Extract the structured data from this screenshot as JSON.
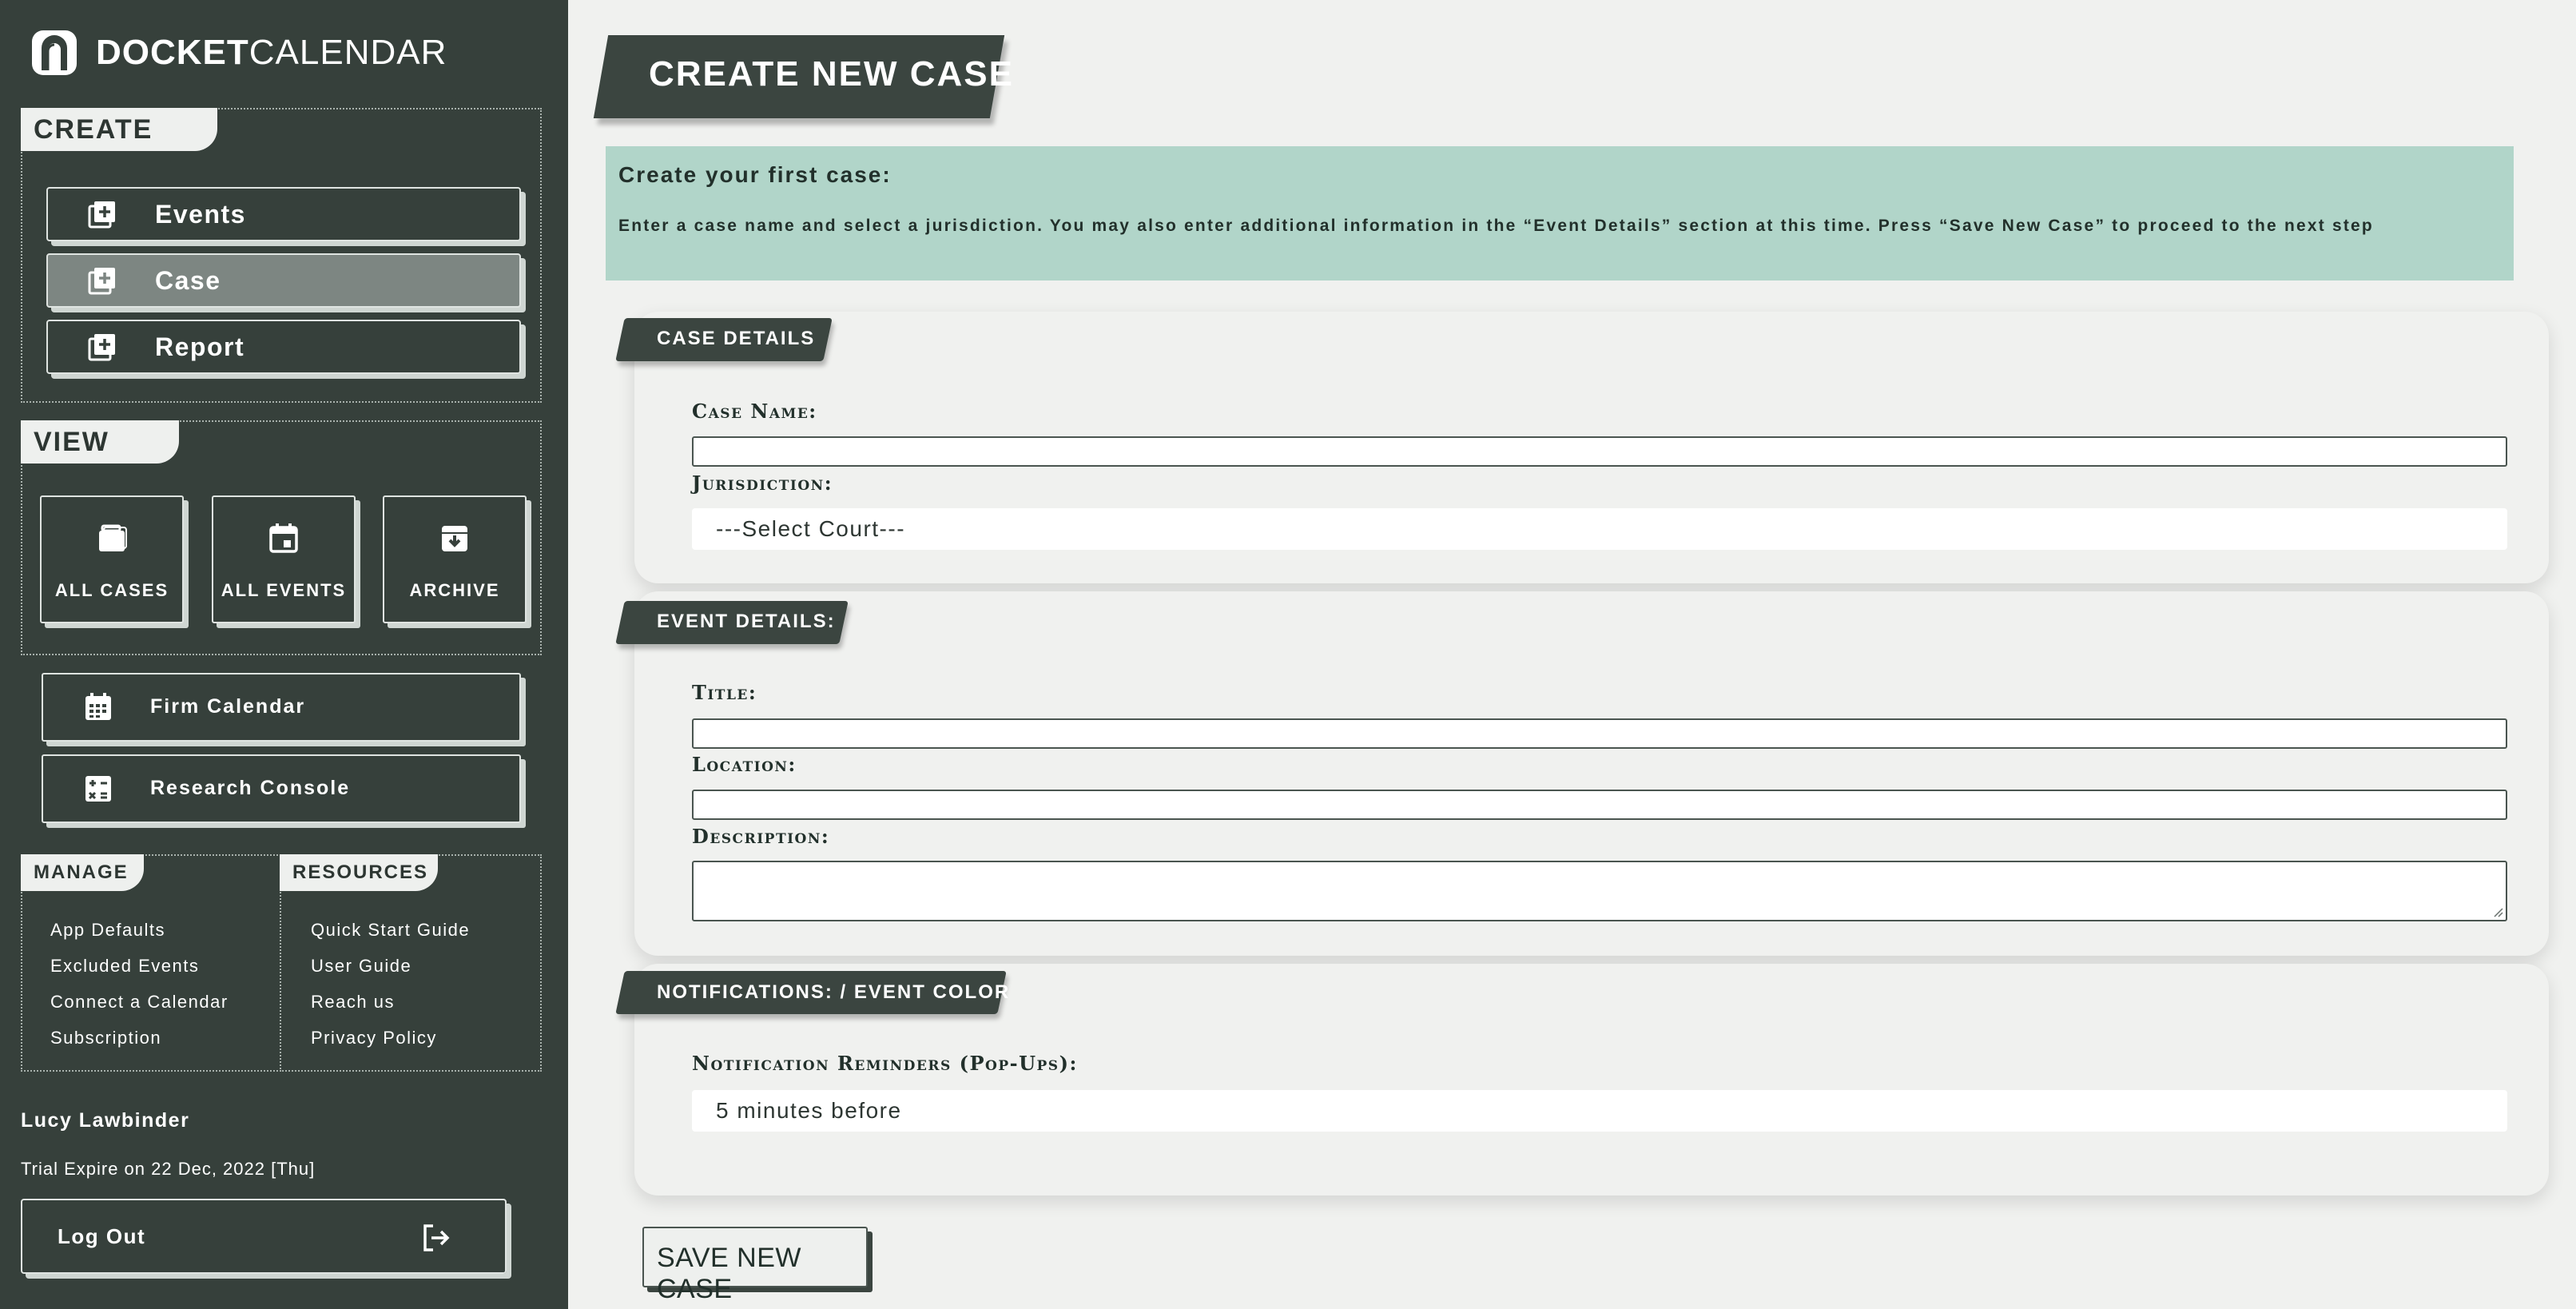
{
  "app": {
    "name_bold": "DOCKET",
    "name_light": "CALENDAR",
    "logo_icon": "arch-logo-icon"
  },
  "colors": {
    "sidebar_bg": "#36403b",
    "tab_dark": "#3b4540",
    "info_bg": "#b1d5c9",
    "page_bg": "#f0f1ef",
    "active_button": "#7d8682"
  },
  "sidebar": {
    "create": {
      "heading": "CREATE",
      "items": [
        {
          "label": "Events",
          "icon": "add-box-icon",
          "active": false
        },
        {
          "label": "Case",
          "icon": "add-box-icon",
          "active": true
        },
        {
          "label": "Report",
          "icon": "add-box-icon",
          "active": false
        }
      ]
    },
    "view": {
      "heading": "VIEW",
      "items": [
        {
          "label": "ALL CASES",
          "icon": "briefcase-icon"
        },
        {
          "label": "ALL EVENTS",
          "icon": "calendar-event-icon"
        },
        {
          "label": "ARCHIVE",
          "icon": "archive-icon"
        }
      ]
    },
    "buttons": [
      {
        "label": "Firm Calendar",
        "icon": "calendar-grid-icon"
      },
      {
        "label": "Research Console",
        "icon": "calculator-icon"
      }
    ],
    "manage": {
      "heading": "MANAGE",
      "items": [
        "App Defaults",
        "Excluded Events",
        "Connect a Calendar",
        "Subscription"
      ]
    },
    "resources": {
      "heading": "RESOURCES",
      "items": [
        "Quick Start Guide",
        "User Guide",
        "Reach us",
        "Privacy Policy"
      ]
    },
    "user": {
      "name": "Lucy Lawbinder",
      "trial": "Trial Expire on 22 Dec, 2022 [Thu]"
    },
    "logout": {
      "label": "Log Out",
      "icon": "logout-icon"
    }
  },
  "main": {
    "page_title": "CREATE NEW CASE",
    "info": {
      "title": "Create your first case:",
      "text": "Enter a case name and select a jurisdiction. You may also enter additional information in the “Event Details” section at this time. Press “Save New Case” to proceed to the next step"
    },
    "case_details": {
      "heading": "CASE DETAILS",
      "case_name_label": "Case Name:",
      "case_name_value": "",
      "jurisdiction_label": "Jurisdiction:",
      "jurisdiction_value": "---Select Court---"
    },
    "event_details": {
      "heading": "EVENT DETAILS:",
      "title_label": "Title:",
      "title_value": "",
      "location_label": "Location:",
      "location_value": "",
      "description_label": "Description:",
      "description_value": ""
    },
    "notifications": {
      "heading": "NOTIFICATIONS: / EVENT COLOR",
      "reminders_label": "Notification Reminders (Pop-Ups):",
      "reminders_value": "5 minutes before"
    },
    "save_label": "SAVE NEW CASE"
  }
}
